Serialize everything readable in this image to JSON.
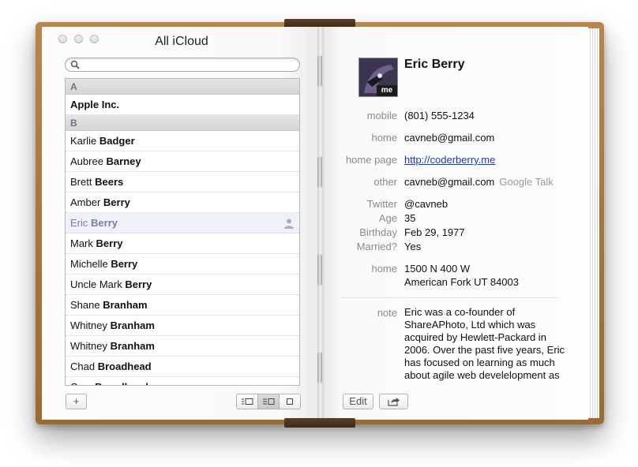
{
  "window": {
    "title": "All iCloud"
  },
  "search": {
    "placeholder": ""
  },
  "contacts": {
    "sections": [
      {
        "letter": "A",
        "rows": [
          {
            "first": "",
            "last": "Apple Inc."
          }
        ]
      },
      {
        "letter": "B",
        "rows": [
          {
            "first": "Karlie",
            "last": "Badger"
          },
          {
            "first": "Aubree",
            "last": "Barney"
          },
          {
            "first": "Brett",
            "last": "Beers"
          },
          {
            "first": "Amber",
            "last": "Berry"
          },
          {
            "first": "Eric",
            "last": "Berry",
            "selected": true
          },
          {
            "first": "Mark",
            "last": "Berry"
          },
          {
            "first": "Michelle",
            "last": "Berry"
          },
          {
            "first": "Uncle Mark",
            "last": "Berry"
          },
          {
            "first": "Shane",
            "last": "Branham"
          },
          {
            "first": "Whitney",
            "last": "Branham"
          },
          {
            "first": "Whitney",
            "last": "Branham"
          },
          {
            "first": "Chad",
            "last": "Broadhead"
          },
          {
            "first": "Cory",
            "last": "Broadhead"
          }
        ]
      }
    ]
  },
  "toolbar": {
    "add_label": "+",
    "edit_label": "Edit"
  },
  "card": {
    "name": "Eric Berry",
    "avatar_tag": "me",
    "mobile_label": "mobile",
    "mobile": "(801) 555-1234",
    "home_email_label": "home",
    "home_email": "cavneb@gmail.com",
    "homepage_label": "home page",
    "homepage": "http://coderberry.me",
    "other_label": "other",
    "other_value": "cavneb@gmail.com",
    "other_service": "Google Talk",
    "twitter_label": "Twitter",
    "twitter": "@cavneb",
    "age_label": "Age",
    "age": "35",
    "birthday_label": "Birthday",
    "birthday": "Feb 29, 1977",
    "married_label": "Married?",
    "married": "Yes",
    "address_label": "home",
    "address_line1": "1500 N 400 W",
    "address_line2": "American Fork UT 84003",
    "note_label": "note",
    "note": "Eric was a co-founder of ShareAPhoto, Ltd which was acquired by Hewlett-Packard in 2006. Over the past five years, Eric has focused on learning as much about agile web develelopment as possible including Ruby on Rails"
  },
  "colors": {
    "selected_text": "#7582a8",
    "link": "#1a35d6",
    "leather": "#a8763a"
  }
}
